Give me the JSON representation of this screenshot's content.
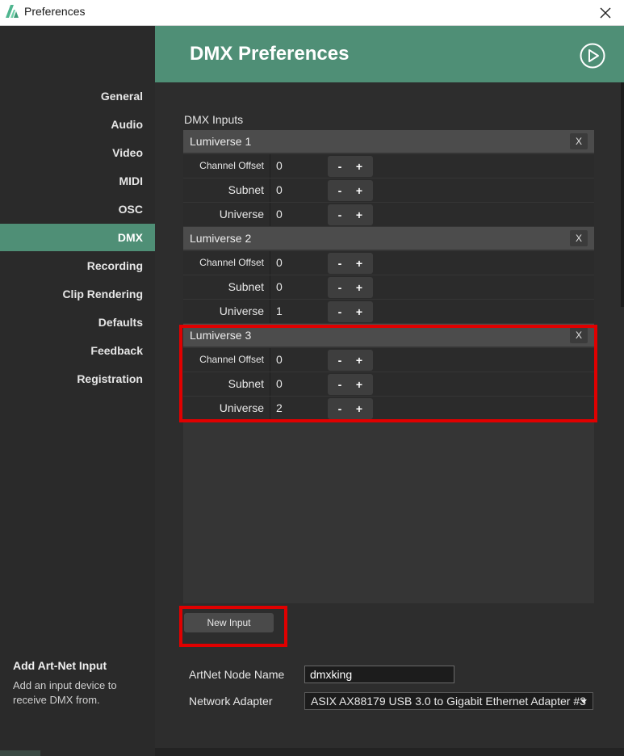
{
  "window": {
    "title": "Preferences",
    "close_glyph": "×"
  },
  "icons": {
    "logo": "resolume-logo-icon",
    "close": "close-icon",
    "play": "play-circle-icon",
    "dropdown": "chevron-down-icon"
  },
  "colors": {
    "accent": "#4f8f76",
    "highlight": "#e00000",
    "background": "#2b2b2b"
  },
  "sidebar": {
    "items": [
      {
        "label": "General",
        "active": false
      },
      {
        "label": "Audio",
        "active": false
      },
      {
        "label": "Video",
        "active": false
      },
      {
        "label": "MIDI",
        "active": false
      },
      {
        "label": "OSC",
        "active": false
      },
      {
        "label": "DMX",
        "active": true
      },
      {
        "label": "Recording",
        "active": false
      },
      {
        "label": "Clip Rendering",
        "active": false
      },
      {
        "label": "Defaults",
        "active": false
      },
      {
        "label": "Feedback",
        "active": false
      },
      {
        "label": "Registration",
        "active": false
      }
    ],
    "help_title": "Add Art-Net Input",
    "help_text": "Add an input device to receive DMX from."
  },
  "header": {
    "title": "DMX Preferences"
  },
  "dmx_inputs": {
    "section_label": "DMX Inputs",
    "remove_label": "X",
    "minus_label": "-",
    "plus_label": "+",
    "groups": [
      {
        "name": "Lumiverse 1",
        "rows": [
          {
            "label": "Channel Offset",
            "value": "0"
          },
          {
            "label": "Subnet",
            "value": "0"
          },
          {
            "label": "Universe",
            "value": "0"
          }
        ]
      },
      {
        "name": "Lumiverse 2",
        "rows": [
          {
            "label": "Channel Offset",
            "value": "0"
          },
          {
            "label": "Subnet",
            "value": "0"
          },
          {
            "label": "Universe",
            "value": "1"
          }
        ]
      },
      {
        "name": "Lumiverse 3",
        "rows": [
          {
            "label": "Channel Offset",
            "value": "0"
          },
          {
            "label": "Subnet",
            "value": "0"
          },
          {
            "label": "Universe",
            "value": "2"
          }
        ]
      }
    ],
    "new_input_label": "New Input"
  },
  "artnet": {
    "node_name_label": "ArtNet Node Name",
    "node_name_value": "dmxking",
    "adapter_label": "Network Adapter",
    "adapter_value": "ASIX AX88179 USB 3.0 to Gigabit Ethernet Adapter #3"
  }
}
